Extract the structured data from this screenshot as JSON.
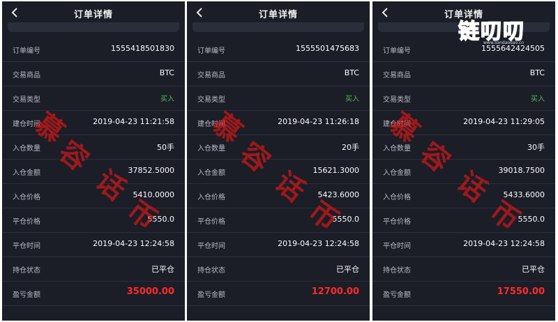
{
  "nav": {
    "title": "订单详情"
  },
  "labels": {
    "order_no": "订单编号",
    "product": "交易商品",
    "type": "交易类型",
    "open_time": "建仓时间",
    "open_qty": "入仓数量",
    "open_amount": "入仓金额",
    "open_price": "入仓价格",
    "close_price": "平仓价格",
    "close_time": "平仓时间",
    "status": "持仓状态",
    "pnl": "盈亏金额"
  },
  "orders": [
    {
      "order_no": "1555418501830",
      "product": "BTC",
      "type": "买入",
      "open_time": "2019-04-23 11:21:58",
      "open_qty": "50手",
      "open_amount": "37852.5000",
      "open_price": "5410.0000",
      "close_price": "5550.0",
      "close_time": "2019-04-23 12:24:58",
      "status": "已平仓",
      "pnl": "35000.00"
    },
    {
      "order_no": "1555501475683",
      "product": "BTC",
      "type": "买入",
      "open_time": "2019-04-23 11:26:18",
      "open_qty": "20手",
      "open_amount": "15621.3000",
      "open_price": "5423.6000",
      "close_price": "5550.0",
      "close_time": "2019-04-23 12:24:58",
      "status": "已平仓",
      "pnl": "12700.00"
    },
    {
      "order_no": "1555642424505",
      "product": "BTC",
      "type": "买入",
      "open_time": "2019-04-23 11:29:05",
      "open_qty": "30手",
      "open_amount": "39018.7500",
      "open_price": "5433.6000",
      "close_price": "5550.0",
      "close_time": "2019-04-23 12:24:58",
      "status": "已平仓",
      "pnl": "17550.00"
    }
  ],
  "watermark": {
    "chars": [
      "慕",
      "容",
      "话",
      "币"
    ]
  },
  "logo": {
    "text": "链叨叨",
    "sub": "www.liandaodao.cn"
  },
  "colors": {
    "bg": "#1b1d27",
    "buy": "#4fbf5b",
    "pnl": "#ff2b2b"
  }
}
